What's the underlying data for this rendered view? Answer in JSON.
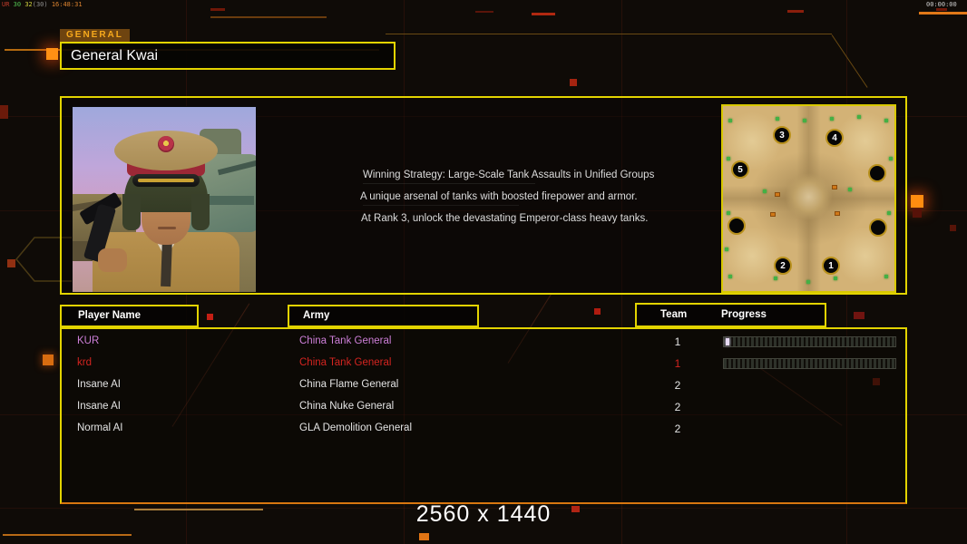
{
  "hud": {
    "perf": {
      "app": "UR",
      "fps": "30",
      "ms": "32",
      "avg": "(30)",
      "clock": "16:48:31"
    },
    "match_timer": "00:00:00"
  },
  "header": {
    "tab_label": "GENERAL",
    "general_name": "General Kwai"
  },
  "bio": {
    "line1": "Winning Strategy: Large-Scale Tank Assaults in Unified Groups",
    "line2": "A unique arsenal of tanks with boosted firepower and armor.",
    "line3": "At Rank 3, unlock the devastating Emperor-class heavy tanks."
  },
  "map": {
    "slot_labels": {
      "s1": "1",
      "s2": "2",
      "s3": "3",
      "s4": "4",
      "s5": "5"
    },
    "unnumbered_slots": 3
  },
  "lobby": {
    "headers": {
      "player": "Player Name",
      "army": "Army",
      "team": "Team",
      "progress": "Progress"
    },
    "rows": [
      {
        "player": "KUR",
        "army": "China Tank General",
        "team": "1",
        "has_progress_bar": true,
        "progress_pct": 2
      },
      {
        "player": "krd",
        "army": "China Tank General",
        "team": "1",
        "has_progress_bar": true,
        "progress_pct": 0
      },
      {
        "player": "Insane AI",
        "army": "China Flame General",
        "team": "2",
        "has_progress_bar": false,
        "progress_pct": null
      },
      {
        "player": "Insane AI",
        "army": "China Nuke General",
        "team": "2",
        "has_progress_bar": false,
        "progress_pct": null
      },
      {
        "player": "Normal AI",
        "army": "GLA Demolition General",
        "team": "2",
        "has_progress_bar": false,
        "progress_pct": null
      }
    ]
  },
  "footer": {
    "resolution_label": "2560 x 1440"
  },
  "colors": {
    "accent_yellow": "#e3d400",
    "accent_orange": "#ff8c10",
    "player1_violet": "#cd7fd8",
    "player2_red": "#d42420",
    "text": "#e4e4e4",
    "map_dot_green": "#44b044"
  }
}
